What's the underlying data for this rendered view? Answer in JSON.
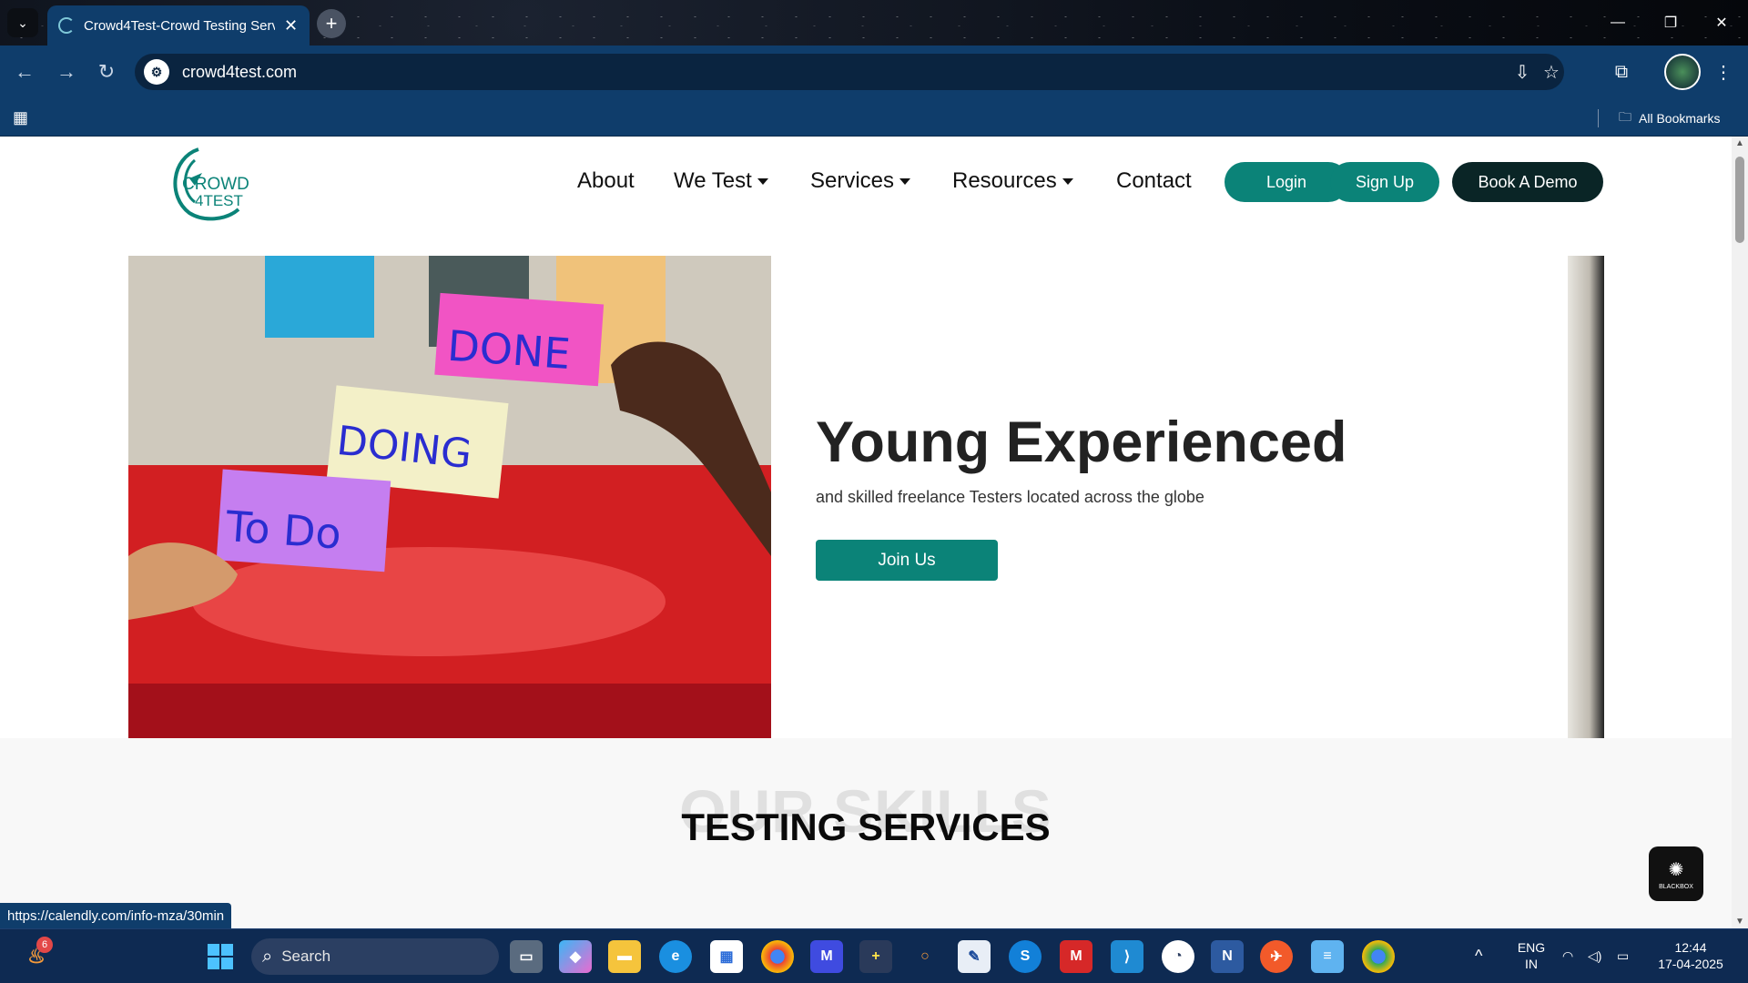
{
  "browser": {
    "tab_title": "Crowd4Test-Crowd Testing Serv",
    "tab_close": "✕",
    "new_tab": "+",
    "url": "crowd4test.com",
    "bookmarks_label": "All Bookmarks"
  },
  "site": {
    "logo_text_line1": "CROWD",
    "logo_text_line2": "4TEST",
    "nav": {
      "about": "About",
      "we_test": "We Test",
      "services": "Services",
      "resources": "Resources",
      "contact": "Contact"
    },
    "buttons": {
      "login": "Login",
      "signup": "Sign Up",
      "demo": "Book A Demo"
    },
    "colors": {
      "accent": "#0b8378",
      "dark_button": "#0a2526"
    },
    "hero": {
      "sticky_done": "DONE",
      "sticky_doing": "DOING",
      "sticky_todo": "To Do",
      "title": "Young Experienced",
      "subtitle": "and skilled freelance Testers located across the globe",
      "cta": "Join Us"
    },
    "skills": {
      "background_text": "OUR SKILLS",
      "title": "TESTING SERVICES"
    },
    "blackbox_label": "BLACKBOX"
  },
  "status_bar_url": "https://calendly.com/info-mza/30min",
  "taskbar": {
    "search_placeholder": "Search",
    "notification_badge": "6",
    "lang_line1": "ENG",
    "lang_line2": "IN",
    "time": "12:44",
    "date": "17-04-2025"
  }
}
